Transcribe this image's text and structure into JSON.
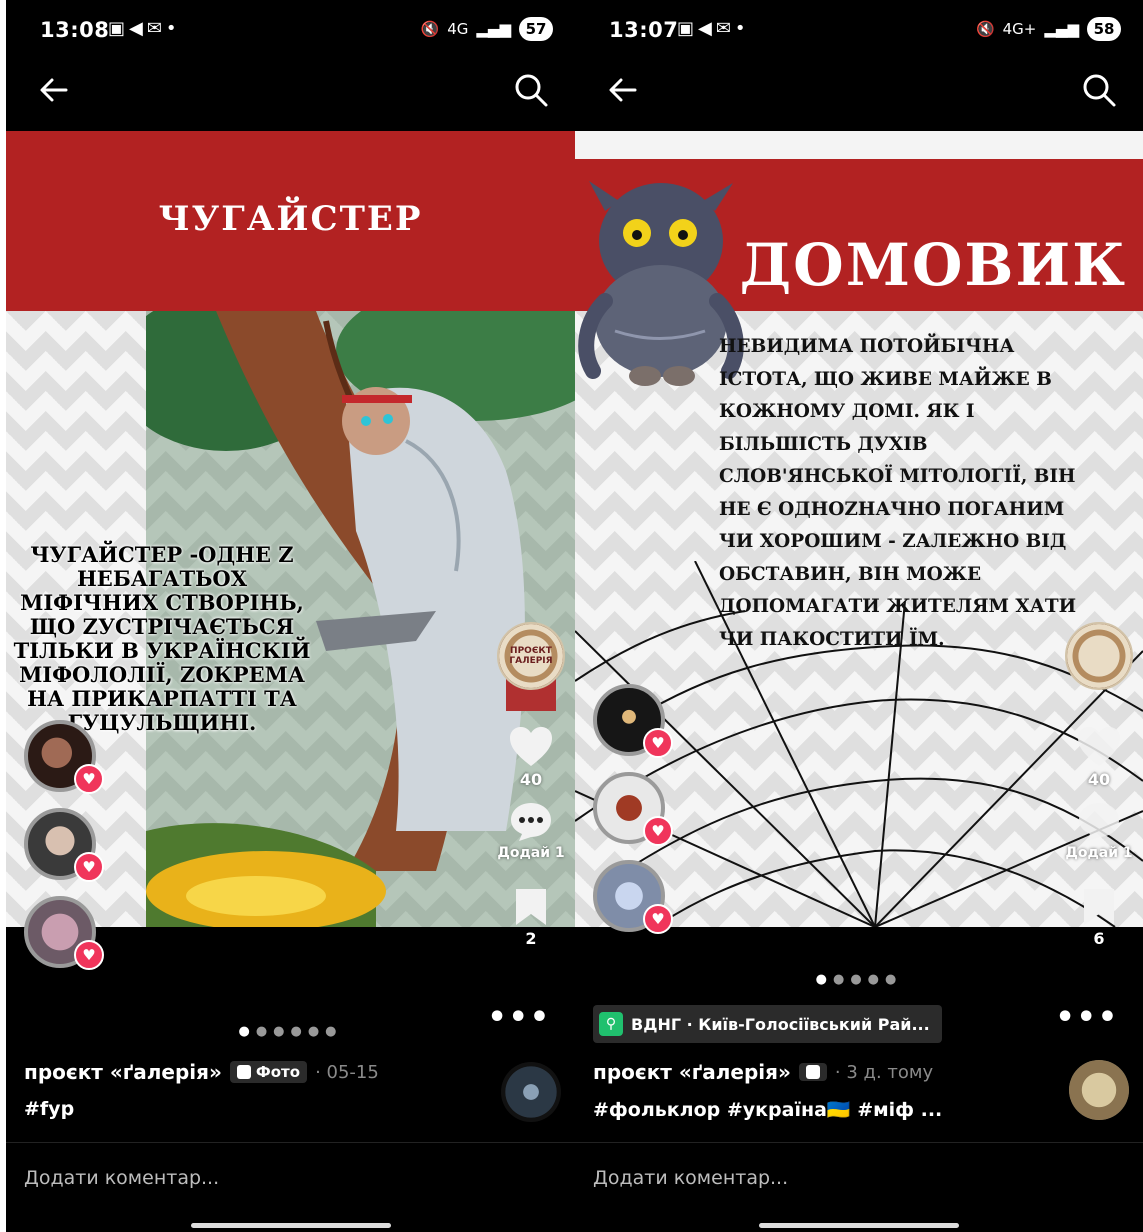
{
  "left": {
    "status": {
      "time": "13:08",
      "network": "4G",
      "battery": "57"
    },
    "post": {
      "title": "ЧУГАЙСТЕР",
      "body": "ЧУГАЙСТЕР -ОДНЕ Z НЕБАГАТЬОХ МІФІЧНИХ СТВОРІНЬ, ЩО ZУСТРІЧАЄТЬСЯ ТІЛЬКИ В УКРАЇНСКІЙ МІФОЛОЛІЇ, ZОКРЕМА НА ПРИКАРПАТТІ ТА ГУЦУЛЬЩИНІ."
    },
    "actions": {
      "likes": "40",
      "comments_label": "Додай 1",
      "saves": "2"
    },
    "creator_badge": "ПРОЄКТ ГАЛЕРІЯ",
    "meta": {
      "author": "проєкт «ґалерія»",
      "type": "Фото",
      "date": "· 05-15",
      "tags": "#fyp"
    },
    "comment_placeholder": "Додати коментар..."
  },
  "right": {
    "status": {
      "time": "13:07",
      "network": "4G+",
      "battery": "58"
    },
    "post": {
      "title": "ДОМОВИК",
      "body": "НЕВИДИМА ПОТОЙБІЧНА ІСТОТА, ЩО ЖИВЕ МАЙЖЕ В КОЖНОМУ ДОМІ. ЯК І БІЛЬШІСТЬ ДУХІВ СЛОВ'ЯНСЬКОЇ МІТОЛОГІЇ, ВІН НЕ Є ОДНОZНАЧНО ПОГАНИМ ЧИ ХОРОШИМ - ZАЛЕЖНО ВІД ОБСТАВИН, ВІН МОЖЕ ДОПОМАГАТИ ЖИТЕЛЯМ ХАТИ ЧИ ПАКОСТИТИ ЇМ."
    },
    "actions": {
      "likes": "40",
      "comments_label": "Додай 1",
      "saves": "6"
    },
    "location": "ВДНГ · Київ-Голосіївський Рай...",
    "meta": {
      "author": "проєкт «ґалерія»",
      "date": "· 3 д. тому",
      "tags": "#фольклор #україна🇺🇦 #міф ..."
    },
    "comment_placeholder": "Додати коментар..."
  },
  "colors": {
    "red_band": "#b22222",
    "heart": "#f0355b",
    "location_icon": "#20c06e"
  }
}
